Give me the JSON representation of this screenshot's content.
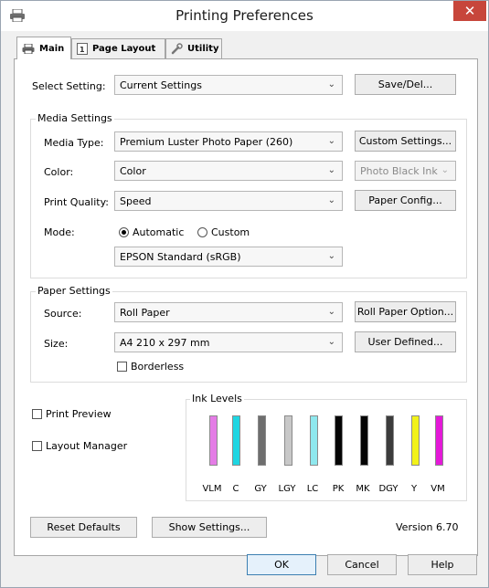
{
  "window": {
    "title": "Printing Preferences",
    "close_glyph": "✕",
    "app_icon": "printer-icon"
  },
  "tabs": [
    {
      "label": "Main",
      "icon": "printer-icon",
      "active": true
    },
    {
      "label": "Page Layout",
      "icon": "page-layout-icon",
      "active": false
    },
    {
      "label": "Utility",
      "icon": "wrench-icon",
      "active": false
    }
  ],
  "select_setting": {
    "label": "Select Setting:",
    "value": "Current Settings",
    "button": "Save/Del..."
  },
  "media_settings": {
    "title": "Media Settings",
    "media_type_label": "Media Type:",
    "media_type_value": "Premium Luster Photo Paper (260)",
    "custom_settings_button": "Custom Settings...",
    "color_label": "Color:",
    "color_value": "Color",
    "ink_value": "Photo Black Ink",
    "print_quality_label": "Print Quality:",
    "print_quality_value": "Speed",
    "paper_config_button": "Paper Config...",
    "mode_label": "Mode:",
    "mode_automatic": "Automatic",
    "mode_custom": "Custom",
    "mode_selected": "Automatic",
    "mode_setting_value": "EPSON Standard (sRGB)"
  },
  "paper_settings": {
    "title": "Paper Settings",
    "source_label": "Source:",
    "source_value": "Roll Paper",
    "roll_paper_option_button": "Roll Paper Option...",
    "size_label": "Size:",
    "size_value": "A4 210 x 297 mm",
    "user_defined_button": "User Defined...",
    "borderless_label": "Borderless",
    "borderless_checked": false
  },
  "options": {
    "print_preview_label": "Print Preview",
    "print_preview_checked": false,
    "layout_manager_label": "Layout Manager",
    "layout_manager_checked": false
  },
  "ink_levels": {
    "title": "Ink Levels",
    "inks": [
      {
        "label": "VLM",
        "color": "#e47ce6"
      },
      {
        "label": "C",
        "color": "#1fd6e2"
      },
      {
        "label": "GY",
        "color": "#6e6e6e"
      },
      {
        "label": "LGY",
        "color": "#c8c8c8"
      },
      {
        "label": "LC",
        "color": "#8fe8ee"
      },
      {
        "label": "PK",
        "color": "#050505"
      },
      {
        "label": "MK",
        "color": "#050505"
      },
      {
        "label": "DGY",
        "color": "#3c3c3c"
      },
      {
        "label": "Y",
        "color": "#f2f21a"
      },
      {
        "label": "VM",
        "color": "#e419d8"
      }
    ]
  },
  "footer": {
    "reset_defaults_button": "Reset Defaults",
    "show_settings_button": "Show Settings...",
    "version": "Version 6.70"
  },
  "dialog_buttons": {
    "ok": "OK",
    "cancel": "Cancel",
    "help": "Help"
  }
}
